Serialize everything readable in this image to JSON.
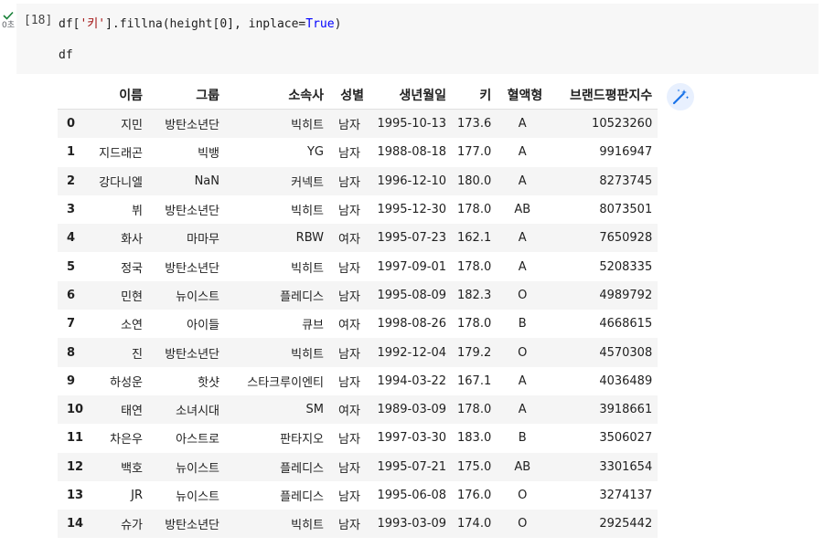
{
  "cell": {
    "status_icon": "check-icon",
    "exec_time": "0초",
    "exec_count": "[18]",
    "code": {
      "line1_pre": "df[",
      "line1_str": "'키'",
      "line1_mid": "].fillna(height[0], inplace=",
      "line1_kw": "True",
      "line1_post": ")",
      "line2": "df"
    }
  },
  "magic_button": {
    "icon": "magic-wand-icon"
  },
  "table": {
    "columns": [
      "",
      "이름",
      "그룹",
      "소속사",
      "성별",
      "생년월일",
      "키",
      "혈액형",
      "브랜드평판지수"
    ],
    "rows": [
      [
        "0",
        "지민",
        "방탄소년단",
        "빅히트",
        "남자",
        "1995-10-13",
        "173.6",
        "A",
        "10523260"
      ],
      [
        "1",
        "지드래곤",
        "빅뱅",
        "YG",
        "남자",
        "1988-08-18",
        "177.0",
        "A",
        "9916947"
      ],
      [
        "2",
        "강다니엘",
        "NaN",
        "커넥트",
        "남자",
        "1996-12-10",
        "180.0",
        "A",
        "8273745"
      ],
      [
        "3",
        "뷔",
        "방탄소년단",
        "빅히트",
        "남자",
        "1995-12-30",
        "178.0",
        "AB",
        "8073501"
      ],
      [
        "4",
        "화사",
        "마마무",
        "RBW",
        "여자",
        "1995-07-23",
        "162.1",
        "A",
        "7650928"
      ],
      [
        "5",
        "정국",
        "방탄소년단",
        "빅히트",
        "남자",
        "1997-09-01",
        "178.0",
        "A",
        "5208335"
      ],
      [
        "6",
        "민현",
        "뉴이스트",
        "플레디스",
        "남자",
        "1995-08-09",
        "182.3",
        "O",
        "4989792"
      ],
      [
        "7",
        "소연",
        "아이들",
        "큐브",
        "여자",
        "1998-08-26",
        "178.0",
        "B",
        "4668615"
      ],
      [
        "8",
        "진",
        "방탄소년단",
        "빅히트",
        "남자",
        "1992-12-04",
        "179.2",
        "O",
        "4570308"
      ],
      [
        "9",
        "하성운",
        "핫샷",
        "스타크루이엔티",
        "남자",
        "1994-03-22",
        "167.1",
        "A",
        "4036489"
      ],
      [
        "10",
        "태연",
        "소녀시대",
        "SM",
        "여자",
        "1989-03-09",
        "178.0",
        "A",
        "3918661"
      ],
      [
        "11",
        "차은우",
        "아스트로",
        "판타지오",
        "남자",
        "1997-03-30",
        "183.0",
        "B",
        "3506027"
      ],
      [
        "12",
        "백호",
        "뉴이스트",
        "플레디스",
        "남자",
        "1995-07-21",
        "175.0",
        "AB",
        "3301654"
      ],
      [
        "13",
        "JR",
        "뉴이스트",
        "플레디스",
        "남자",
        "1995-06-08",
        "176.0",
        "O",
        "3274137"
      ],
      [
        "14",
        "슈가",
        "방탄소년단",
        "빅히트",
        "남자",
        "1993-03-09",
        "174.0",
        "O",
        "2925442"
      ]
    ]
  }
}
